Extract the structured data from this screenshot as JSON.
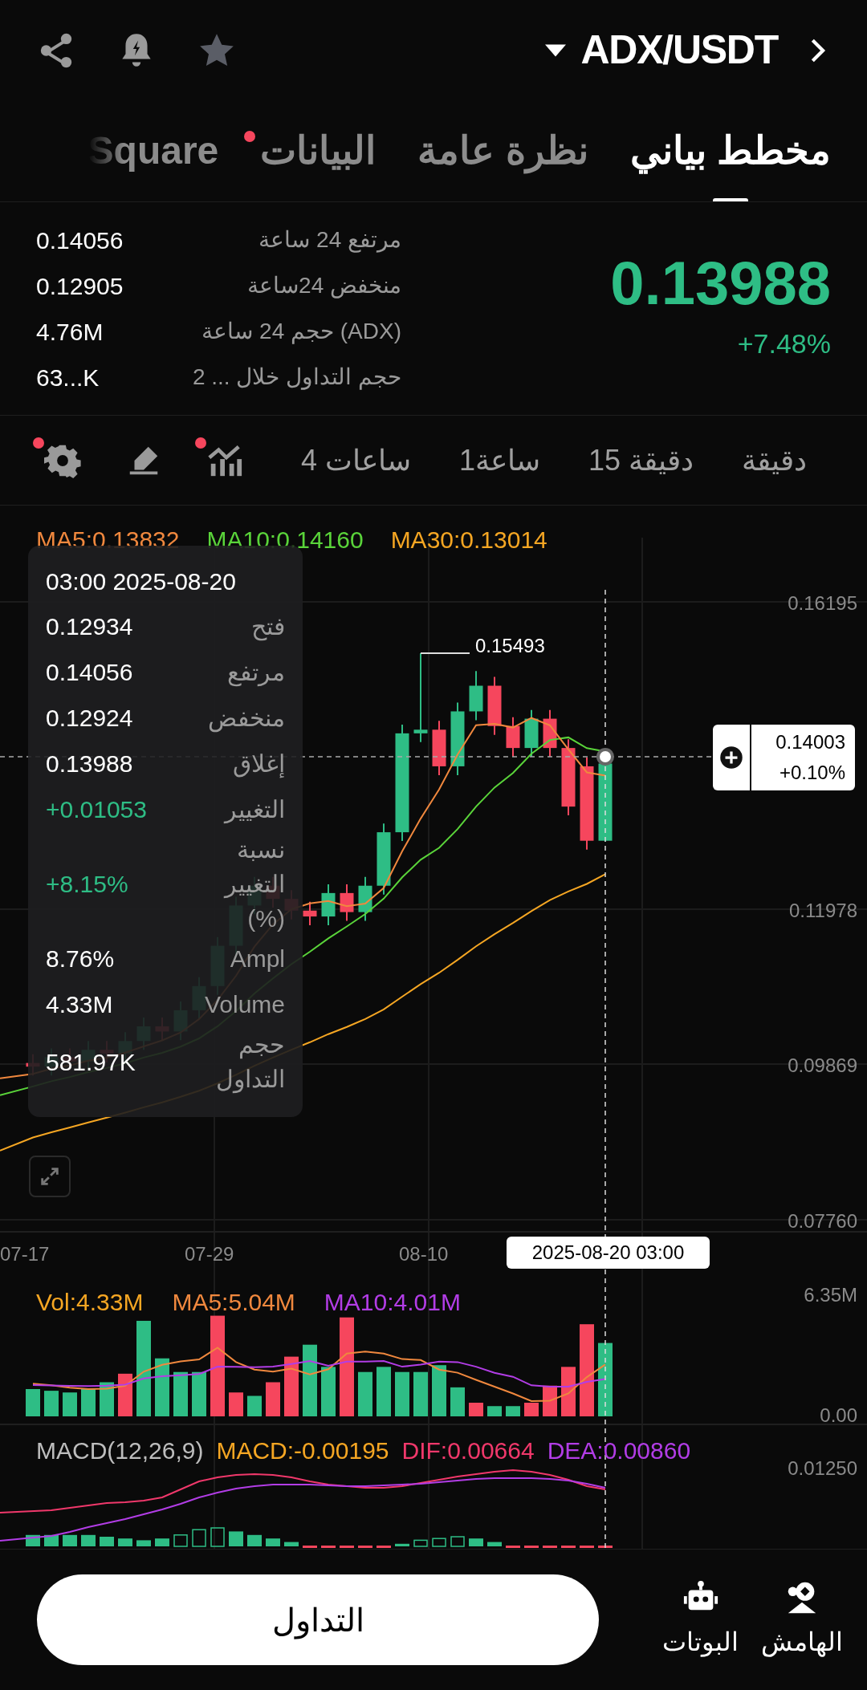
{
  "header": {
    "title": "ADX/USDT"
  },
  "tabs": [
    {
      "label": "مخطط بياني",
      "selected": true,
      "badge": false
    },
    {
      "label": "نظرة عامة",
      "selected": false,
      "badge": false
    },
    {
      "label": "البيانات",
      "selected": false,
      "badge": true
    },
    {
      "label": "Square",
      "selected": false,
      "badge": false
    }
  ],
  "ticker": {
    "price": "0.13988",
    "change": "+7.48%",
    "stats": [
      {
        "label": "مرتفع 24 ساعة",
        "value": "0.14056"
      },
      {
        "label": "منخفض 24ساعة",
        "value": "0.12905"
      },
      {
        "label": "حجم 24 ساعة (ADX)",
        "value": "4.76M"
      },
      {
        "label": "حجم التداول خلال ... 2",
        "value": "63...K"
      }
    ]
  },
  "intervals": [
    {
      "label": "دقيقة"
    },
    {
      "label": "15 دقيقة"
    },
    {
      "label": "1ساعة"
    },
    {
      "label": "4 ساعات"
    }
  ],
  "tools": [
    {
      "kind": "indicators",
      "badge": true
    },
    {
      "kind": "draw",
      "badge": false
    },
    {
      "kind": "settings",
      "badge": true
    }
  ],
  "chart": {
    "legend": [
      {
        "text": "MA30:0.13014",
        "color": "#f5a623"
      },
      {
        "text": "MA10:0.14160",
        "color": "#5ad43a"
      },
      {
        "text": "MA5:0.13832",
        "color": "#f0883e"
      }
    ],
    "price_axis": [
      "0.16195",
      "0.11978",
      "0.09869",
      "0.07760"
    ],
    "high_marker": "0.15493",
    "date_axis": [
      "08-10",
      "07-29",
      "07-17"
    ],
    "crosshair": {
      "price": "0.14003",
      "change": "+0.10%",
      "date": "2025-08-20 03:00"
    }
  },
  "tooltip": {
    "datetime": "03:00 2025-08-20",
    "rows": [
      {
        "label": "فتح",
        "value": "0.12934",
        "kind": "plain"
      },
      {
        "label": "مرتفع",
        "value": "0.14056",
        "kind": "plain"
      },
      {
        "label": "منخفض",
        "value": "0.12924",
        "kind": "plain"
      },
      {
        "label": "إغلاق",
        "value": "0.13988",
        "kind": "plain"
      },
      {
        "label": "التغيير",
        "value": "+0.01053",
        "kind": "up"
      },
      {
        "label": "نسبة التغيير (%)",
        "value": "+8.15%",
        "kind": "up"
      },
      {
        "label": "Ampl",
        "value": "8.76%",
        "kind": "plain"
      },
      {
        "label": "Volume",
        "value": "4.33M",
        "kind": "plain"
      },
      {
        "label": "حجم التداول",
        "value": "581.97K",
        "kind": "plain"
      }
    ]
  },
  "volume": {
    "legend": [
      {
        "text": "MA10:4.01M",
        "color": "#b23de6"
      },
      {
        "text": "MA5:5.04M",
        "color": "#f0883e"
      },
      {
        "text": "Vol:4.33M",
        "color": "#f5a623"
      }
    ],
    "axis": [
      "6.35M",
      "0.00"
    ]
  },
  "macd": {
    "legend": [
      {
        "text": "DEA:0.00860",
        "color": "#b23de6"
      },
      {
        "text": "DIF:0.00664",
        "color": "#f0386b"
      },
      {
        "text": "MACD:-0.00195",
        "color": "#f5a623"
      },
      {
        "text": "MACD(12,26,9)",
        "color": "#bdbdbd"
      }
    ],
    "axis": "0.01250"
  },
  "bottom": {
    "nav": [
      {
        "label": "الهامش",
        "kind": "margin"
      },
      {
        "label": "البوتات",
        "kind": "robot"
      }
    ],
    "trade_button": "التداول"
  }
}
